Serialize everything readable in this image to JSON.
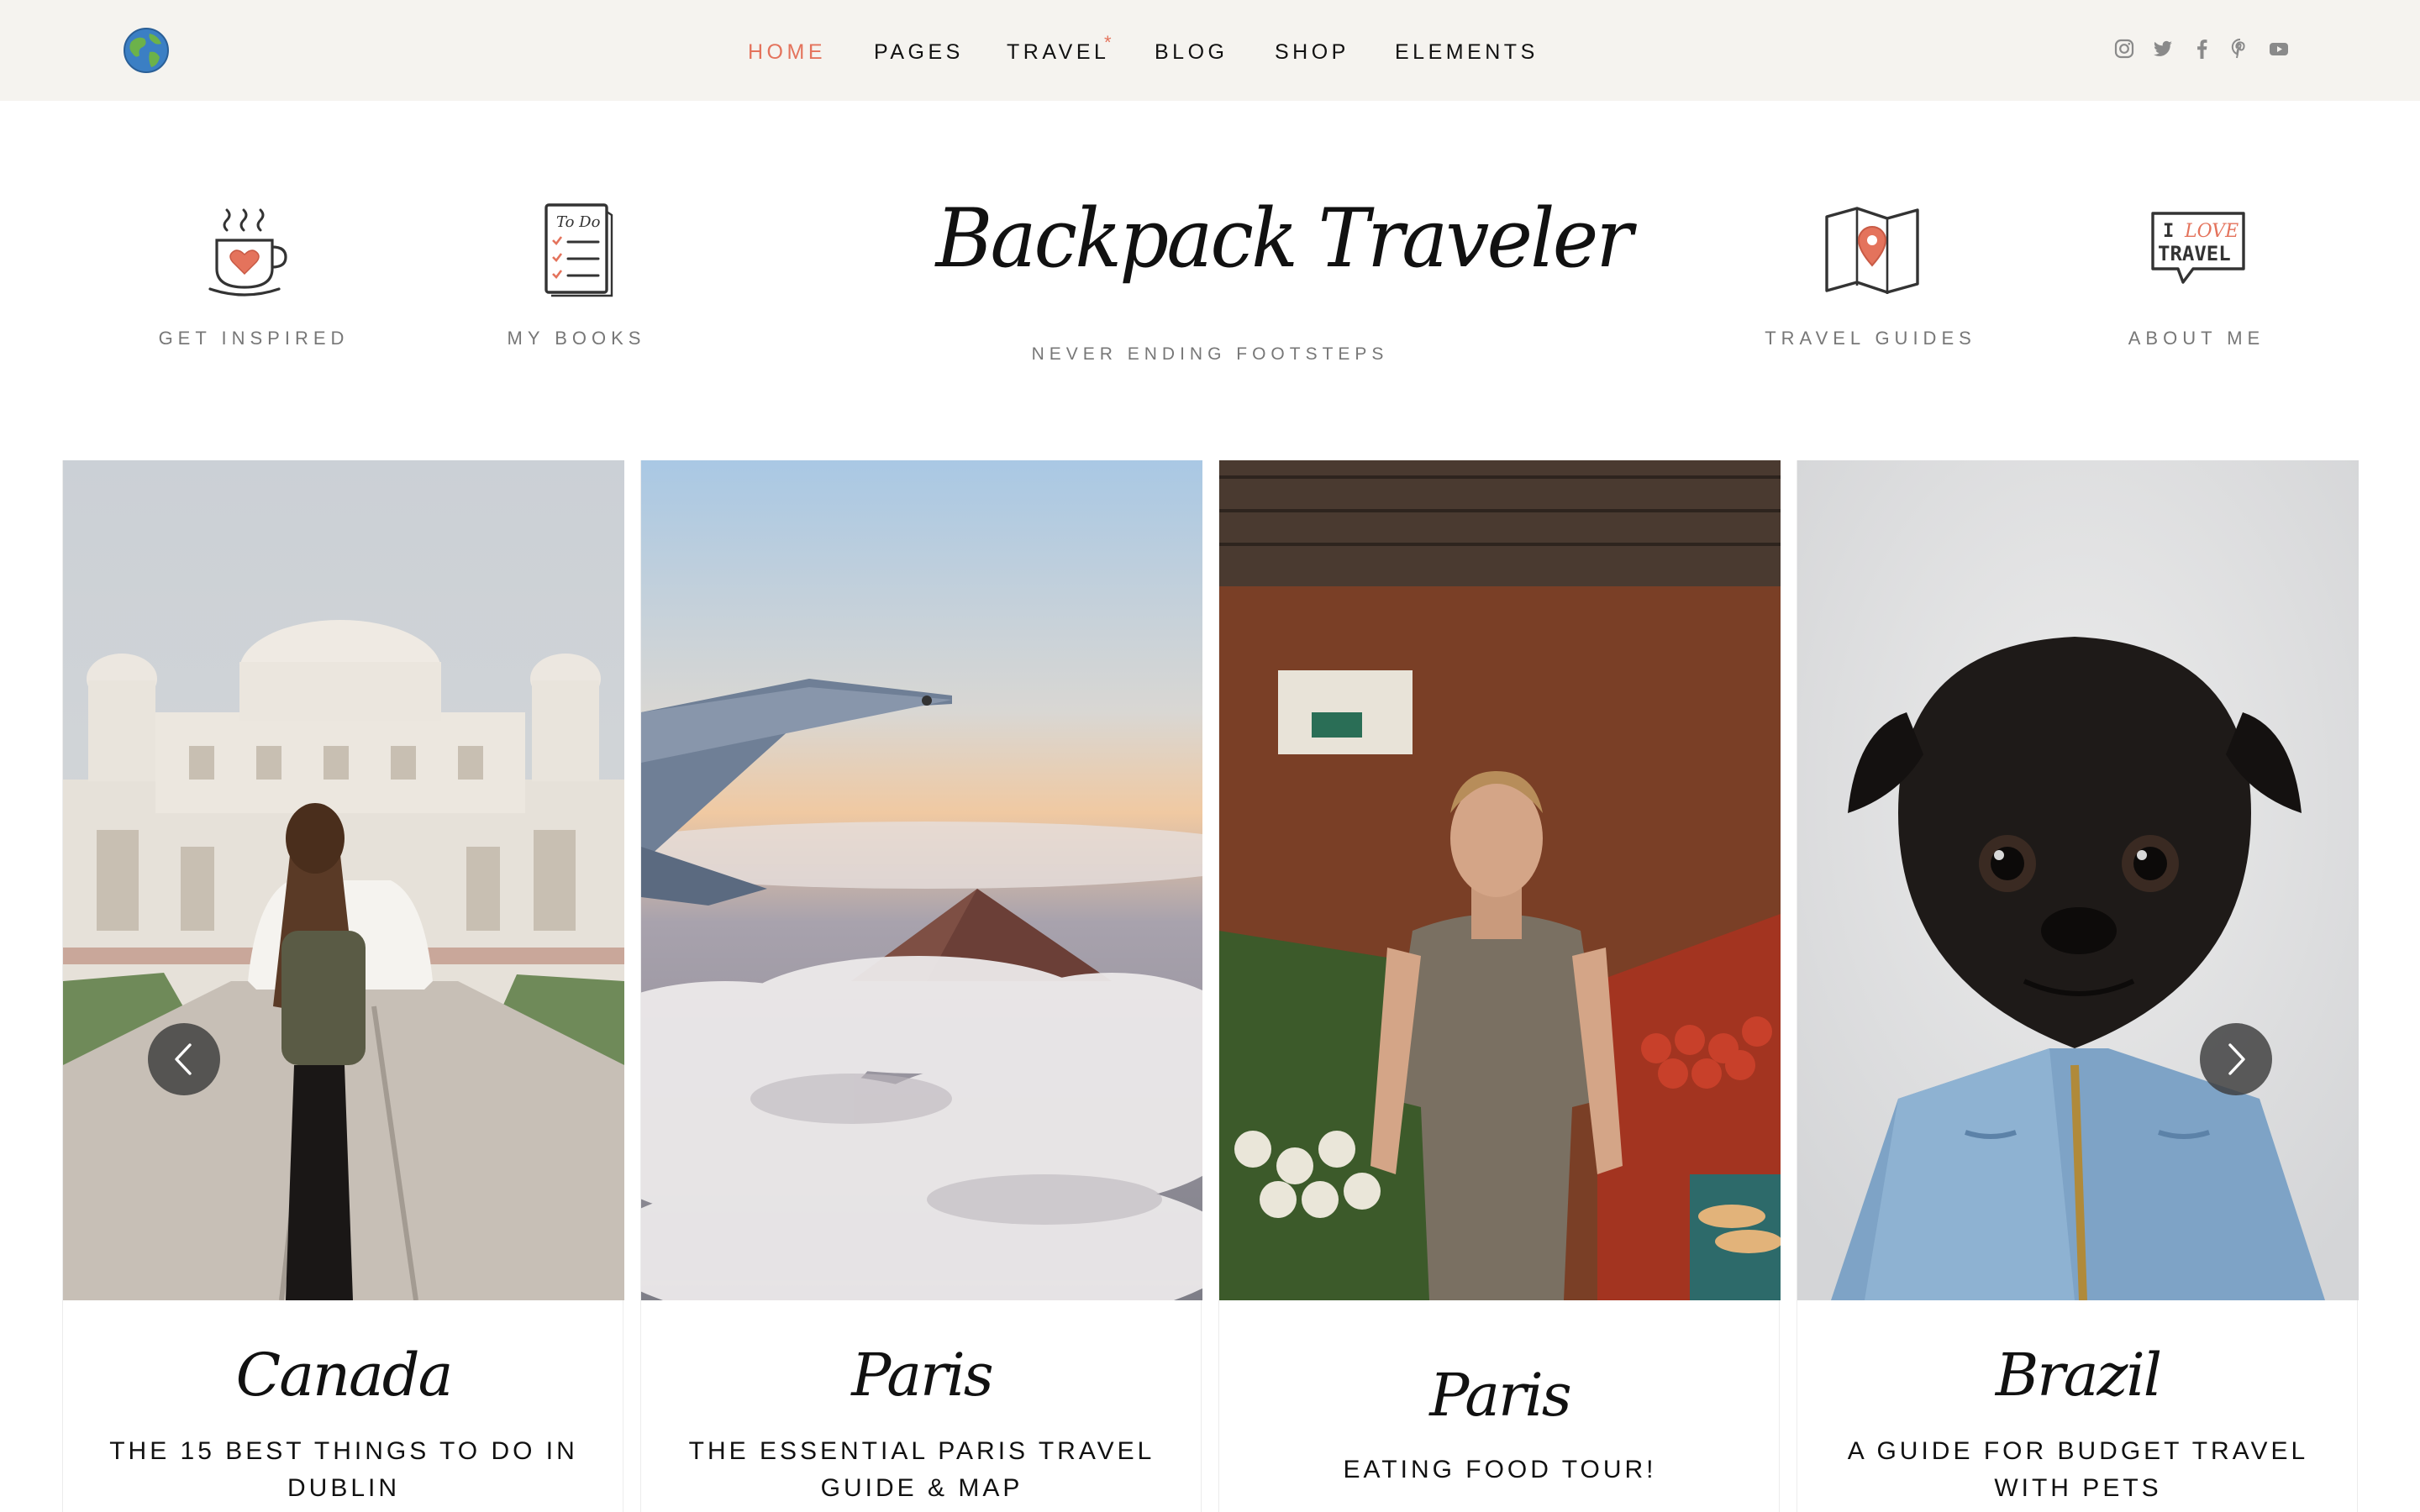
{
  "site": {
    "logo_text": "Backpack Traveler",
    "tagline": "NEVER ENDING FOOTSTEPS"
  },
  "nav": {
    "items": [
      {
        "label": "HOME",
        "active": true
      },
      {
        "label": "PAGES"
      },
      {
        "label": "TRAVEL",
        "starred": true
      },
      {
        "label": "BLOG"
      },
      {
        "label": "SHOP"
      },
      {
        "label": "ELEMENTS"
      }
    ],
    "star_glyph": "*"
  },
  "social_icons": [
    "instagram-icon",
    "twitter-icon",
    "facebook-icon",
    "pinterest-icon",
    "youtube-icon"
  ],
  "features": [
    {
      "label": "GET INSPIRED",
      "icon": "coffee-cup-icon"
    },
    {
      "label": "MY BOOKS",
      "icon": "todo-list-icon"
    },
    {
      "label": "TRAVEL GUIDES",
      "icon": "map-pin-icon"
    },
    {
      "label": "ABOUT ME",
      "icon": "i-love-travel-sign-icon",
      "icon_text_1": "I",
      "icon_text_2": "LOVE",
      "icon_text_3": "TRAVEL"
    }
  ],
  "todo_icon_text": "To Do",
  "posts": [
    {
      "location": "Canada",
      "title": "THE 15 BEST THINGS TO DO IN DUBLIN"
    },
    {
      "location": "Paris",
      "title": "THE ESSENTIAL PARIS TRAVEL GUIDE & MAP"
    },
    {
      "location": "Paris",
      "title": "EATING FOOD TOUR!"
    },
    {
      "location": "Brazil",
      "title": "A GUIDE FOR BUDGET TRAVEL WITH PETS"
    }
  ],
  "colors": {
    "accent": "#e4735c",
    "topbar_bg": "#f5f3ef",
    "muted_text": "#777777"
  },
  "slider": {
    "prev": "chevron-left-icon",
    "next": "chevron-right-icon"
  }
}
